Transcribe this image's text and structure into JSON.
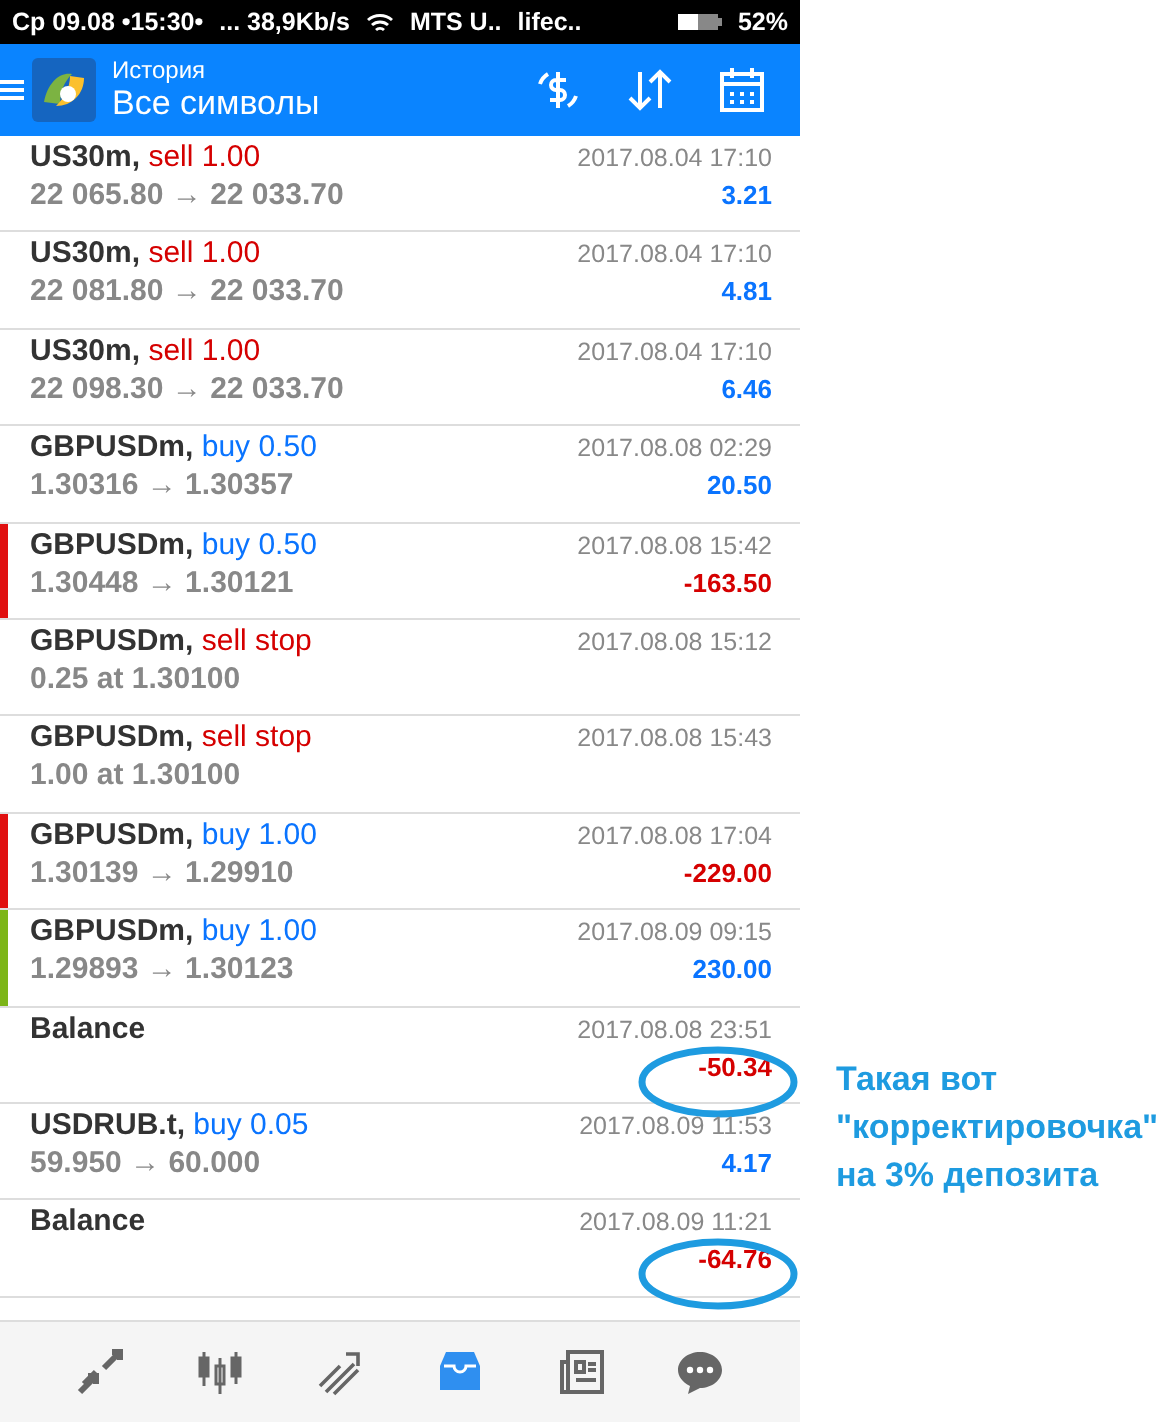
{
  "status_bar": {
    "left": "Ср 09.08 •15:30•",
    "speed": "... 38,9Kb/s",
    "carrier_1": "MTS U..",
    "carrier_2": "lifec..",
    "battery": "52%"
  },
  "header": {
    "title": "История",
    "subtitle": "Все символы"
  },
  "rows": [
    {
      "kind": "trade",
      "symbol": "US30m,",
      "action": {
        "kind": "sell",
        "text": "sell 1.00"
      },
      "prices": "22 065.80 → 22 033.70",
      "date": "2017.08.04 17:10",
      "profit": {
        "kind": "gain",
        "text": "3.21"
      }
    },
    {
      "kind": "trade",
      "symbol": "US30m,",
      "action": {
        "kind": "sell",
        "text": "sell 1.00"
      },
      "prices": "22 081.80 → 22 033.70",
      "date": "2017.08.04 17:10",
      "profit": {
        "kind": "gain",
        "text": "4.81"
      }
    },
    {
      "kind": "trade",
      "symbol": "US30m,",
      "action": {
        "kind": "sell",
        "text": "sell 1.00"
      },
      "prices": "22 098.30 → 22 033.70",
      "date": "2017.08.04 17:10",
      "profit": {
        "kind": "gain",
        "text": "6.46"
      }
    },
    {
      "kind": "trade",
      "symbol": "GBPUSDm,",
      "action": {
        "kind": "buy",
        "text": "buy 0.50"
      },
      "prices": "1.30316 → 1.30357",
      "date": "2017.08.08 02:29",
      "profit": {
        "kind": "gain",
        "text": "20.50"
      }
    },
    {
      "kind": "trade",
      "symbol": "GBPUSDm,",
      "action": {
        "kind": "buy",
        "text": "buy 0.50"
      },
      "prices": "1.30448 → 1.30121",
      "date": "2017.08.08 15:42",
      "profit": {
        "kind": "loss",
        "text": "-163.50"
      },
      "color": "#e01010"
    },
    {
      "kind": "order",
      "symbol": "GBPUSDm,",
      "action": {
        "kind": "sell",
        "text": "sell stop"
      },
      "prices": "0.25 at 1.30100",
      "date": "2017.08.08 15:12"
    },
    {
      "kind": "order",
      "symbol": "GBPUSDm,",
      "action": {
        "kind": "sell",
        "text": "sell stop"
      },
      "prices": "1.00 at 1.30100",
      "date": "2017.08.08 15:43"
    },
    {
      "kind": "trade",
      "symbol": "GBPUSDm,",
      "action": {
        "kind": "buy",
        "text": "buy 1.00"
      },
      "prices": "1.30139 → 1.29910",
      "date": "2017.08.08 17:04",
      "profit": {
        "kind": "loss",
        "text": "-229.00"
      },
      "color": "#e01010"
    },
    {
      "kind": "trade",
      "symbol": "GBPUSDm,",
      "action": {
        "kind": "buy",
        "text": "buy 1.00"
      },
      "prices": "1.29893 → 1.30123",
      "date": "2017.08.09 09:15",
      "profit": {
        "kind": "gain",
        "text": "230.00"
      },
      "color": "#7cb518"
    },
    {
      "kind": "balance",
      "symbol": "Balance",
      "date": "2017.08.08 23:51",
      "profit": {
        "kind": "loss",
        "text": "-50.34"
      },
      "circled": true
    },
    {
      "kind": "trade",
      "symbol": "USDRUB.t,",
      "action": {
        "kind": "buy",
        "text": "buy 0.05"
      },
      "prices": "59.950 → 60.000",
      "date": "2017.08.09 11:53",
      "profit": {
        "kind": "gain",
        "text": "4.17"
      }
    },
    {
      "kind": "balance",
      "symbol": "Balance",
      "date": "2017.08.09 11:21",
      "profit": {
        "kind": "loss",
        "text": "-64.76"
      },
      "circled": true
    }
  ],
  "bottom_nav": [
    {
      "kind": "trade",
      "selected": false
    },
    {
      "kind": "quotes",
      "selected": false
    },
    {
      "kind": "chart",
      "selected": false
    },
    {
      "kind": "history",
      "selected": true
    },
    {
      "kind": "news",
      "selected": false
    },
    {
      "kind": "chat",
      "selected": false
    }
  ],
  "annotation": {
    "lines": [
      "Такая вот",
      "\"корректировочка\"",
      "на 3% депозита"
    ]
  }
}
